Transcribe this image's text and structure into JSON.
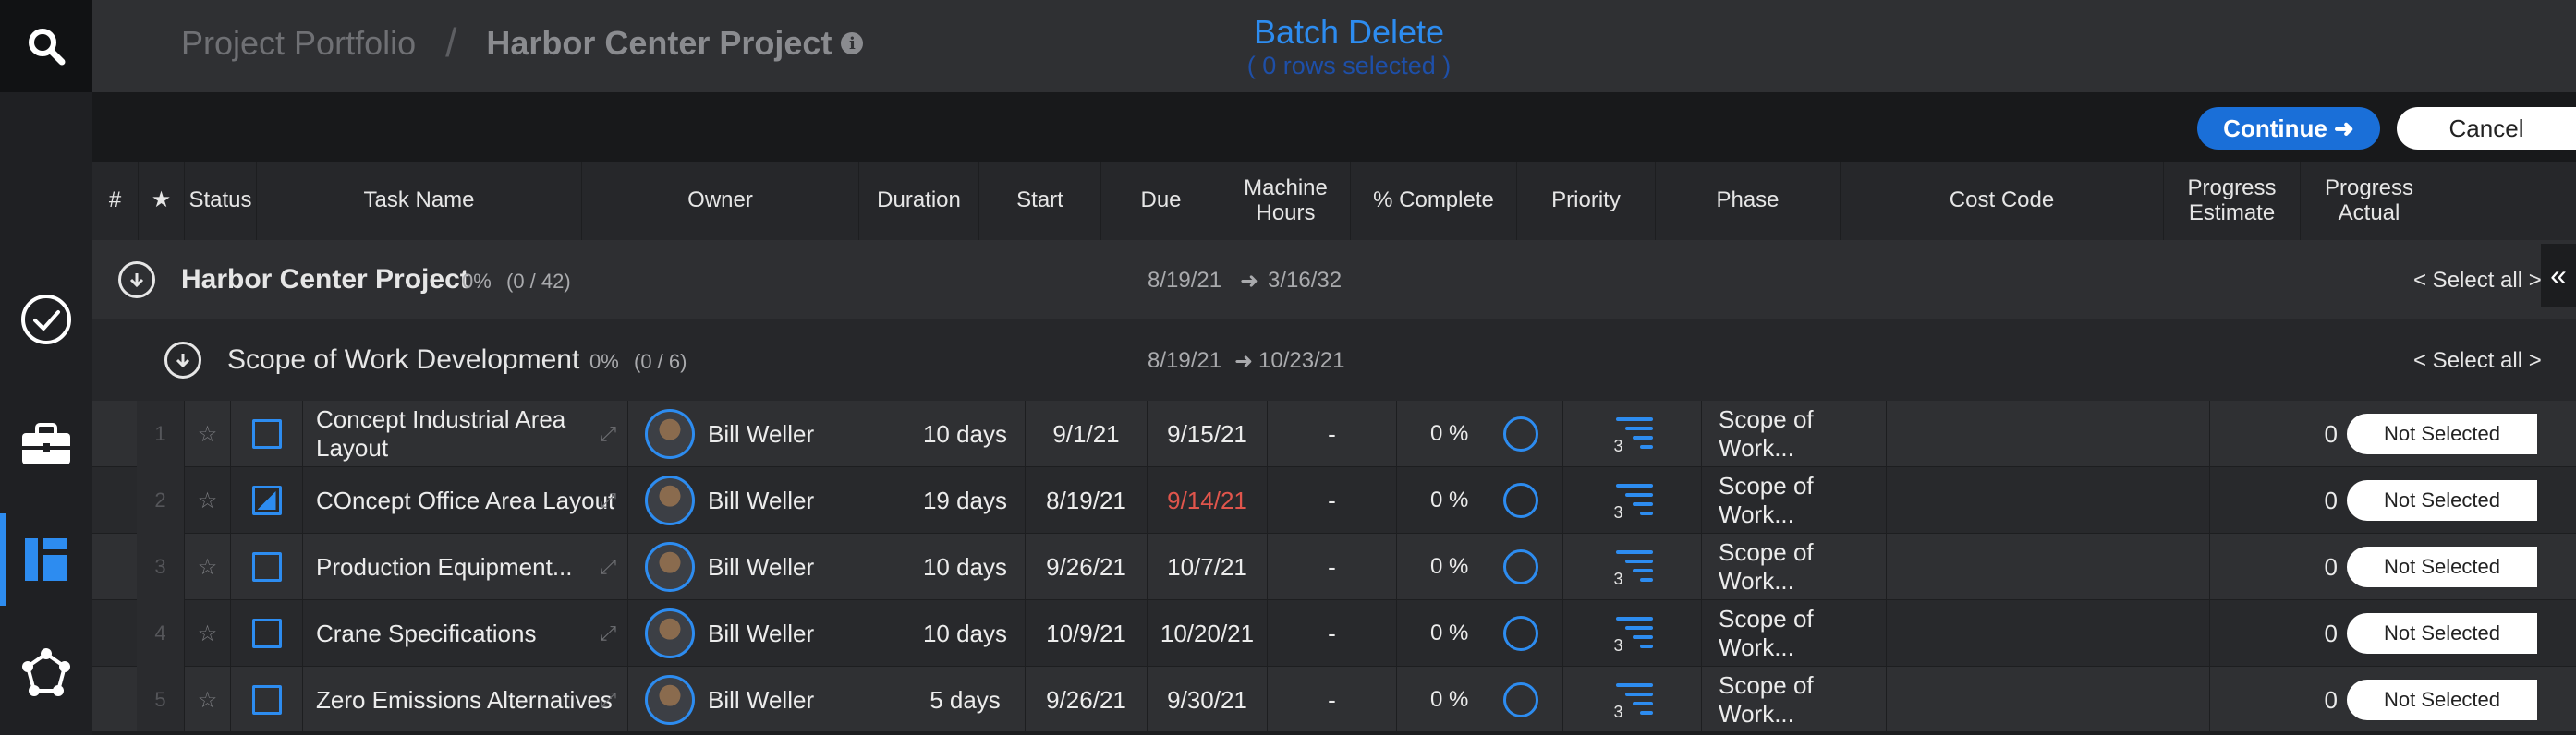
{
  "breadcrumb": {
    "root": "Project Portfolio",
    "separator": "/",
    "current": "Harbor Center Project"
  },
  "batch": {
    "title": "Batch Delete",
    "subtitle": "( 0 rows selected )"
  },
  "actions": {
    "continue": "Continue ➜",
    "cancel": "Cancel"
  },
  "columns": {
    "num": "#",
    "star": "★",
    "status": "Status",
    "task_name": "Task Name",
    "owner": "Owner",
    "duration": "Duration",
    "start": "Start",
    "due": "Due",
    "machine_hours": "Machine Hours",
    "pct_complete": "% Complete",
    "priority": "Priority",
    "phase": "Phase",
    "cost_code": "Cost Code",
    "progress_estimate": "Progress Estimate",
    "progress_actual": "Progress Actual"
  },
  "groups": [
    {
      "name": "Harbor Center Project",
      "pct": "0%",
      "count": "(0 / 42)",
      "start": "8/19/21",
      "arrow": "➜",
      "end": "3/16/32",
      "select_all": "< Select all >"
    },
    {
      "name": "Scope of Work Development",
      "pct": "0%",
      "count": "(0 / 6)",
      "start": "8/19/21",
      "arrow": "➜",
      "end": "10/23/21",
      "select_all": "< Select all >"
    }
  ],
  "collapse_icon": "«",
  "rows": [
    {
      "num": "1",
      "star": "☆",
      "name": "Concept Industrial Area Layout",
      "owner": "Bill Weller",
      "duration": "10 days",
      "start": "9/1/21",
      "due": "9/15/21",
      "due_late": false,
      "machine_hours": "-",
      "pct": "0 %",
      "priority": "3",
      "phase": "Scope of Work...",
      "cost_code": "",
      "progress_estimate": "0",
      "progress_actual": "Not Selected",
      "status_half": false
    },
    {
      "num": "2",
      "star": "☆",
      "name": "COncept Office Area Layout",
      "owner": "Bill Weller",
      "duration": "19 days",
      "start": "8/19/21",
      "due": "9/14/21",
      "due_late": true,
      "machine_hours": "-",
      "pct": "0 %",
      "priority": "3",
      "phase": "Scope of Work...",
      "cost_code": "",
      "progress_estimate": "0",
      "progress_actual": "Not Selected",
      "status_half": true
    },
    {
      "num": "3",
      "star": "☆",
      "name": "Production Equipment...",
      "owner": "Bill Weller",
      "duration": "10 days",
      "start": "9/26/21",
      "due": "10/7/21",
      "due_late": false,
      "machine_hours": "-",
      "pct": "0 %",
      "priority": "3",
      "phase": "Scope of Work...",
      "cost_code": "",
      "progress_estimate": "0",
      "progress_actual": "Not Selected",
      "status_half": false
    },
    {
      "num": "4",
      "star": "☆",
      "name": "Crane Specifications",
      "owner": "Bill Weller",
      "duration": "10 days",
      "start": "10/9/21",
      "due": "10/20/21",
      "due_late": false,
      "machine_hours": "-",
      "pct": "0 %",
      "priority": "3",
      "phase": "Scope of Work...",
      "cost_code": "",
      "progress_estimate": "0",
      "progress_actual": "Not Selected",
      "status_half": false
    },
    {
      "num": "5",
      "star": "☆",
      "name": "Zero Emissions Alternatives",
      "owner": "Bill Weller",
      "duration": "5 days",
      "start": "9/26/21",
      "due": "9/30/21",
      "due_late": false,
      "machine_hours": "-",
      "pct": "0 %",
      "priority": "3",
      "phase": "Scope of Work...",
      "cost_code": "",
      "progress_estimate": "0",
      "progress_actual": "Not Selected",
      "status_half": false
    }
  ],
  "colors": {
    "accent": "#2d8cf0",
    "late": "#e0554c",
    "sidebar": "#1f2023"
  }
}
